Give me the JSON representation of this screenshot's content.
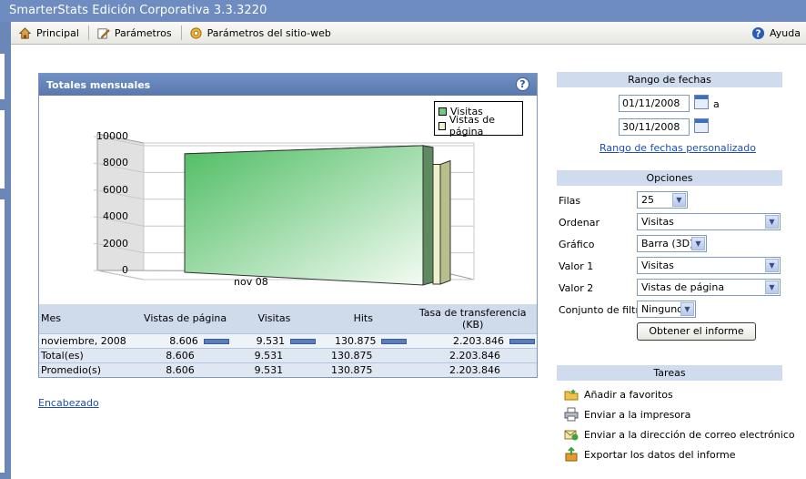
{
  "app": {
    "title": "SmarterStats Edición Corporativa 3.3.3220"
  },
  "toolbar": {
    "principal": "Principal",
    "parametros": "Parámetros",
    "parametros_sitio": "Parámetros del sitio-web",
    "ayuda": "Ayuda"
  },
  "chart_panel": {
    "title": "Totales mensuales",
    "help": "?"
  },
  "chart_data": {
    "type": "bar",
    "categories": [
      "nov 08"
    ],
    "series": [
      {
        "name": "Visitas",
        "values": [
          9531
        ]
      },
      {
        "name": "Vistas de página",
        "values": [
          8606
        ]
      }
    ],
    "ylim": [
      0,
      10000
    ],
    "yticks": [
      "10000",
      "8000",
      "6000",
      "4000",
      "2000",
      "0"
    ],
    "legend": "top-right",
    "colors": {
      "Visitas": "#6fcb7e",
      "Vistas de página": "#eef0cc"
    }
  },
  "table": {
    "headers": [
      "Mes",
      "Vistas de página",
      "Visitas",
      "Hits",
      "Tasa de transferencia (KB)"
    ],
    "rows": [
      [
        "noviembre, 2008",
        "8.606",
        "9.531",
        "130.875",
        "2.203.846"
      ],
      [
        "Total(es)",
        "8.606",
        "9.531",
        "130.875",
        "2.203.846"
      ],
      [
        "Promedio(s)",
        "8.606",
        "9.531",
        "130.875",
        "2.203.846"
      ]
    ]
  },
  "encabezado": "Encabezado",
  "dates": {
    "section": "Rango de fechas",
    "start": "01/11/2008",
    "to": "a",
    "end": "30/11/2008",
    "custom_link": "Rango de fechas personalizado"
  },
  "options": {
    "section": "Opciones",
    "filas_label": "Filas",
    "filas": "25",
    "ordenar_label": "Ordenar",
    "ordenar": "Visitas",
    "grafico_label": "Gráfico",
    "grafico": "Barra (3D)",
    "valor1_label": "Valor 1",
    "valor1": "Visitas",
    "valor2_label": "Valor 2",
    "valor2": "Vistas de página",
    "filtro_label": "Conjunto de filtro",
    "filtro": "Ninguno",
    "submit": "Obtener el informe"
  },
  "tasks": {
    "section": "Tareas",
    "items": [
      "Añadir a favoritos",
      "Enviar a la impresora",
      "Enviar a la dirección de correo electrónico",
      "Exportar los datos del informe"
    ]
  }
}
